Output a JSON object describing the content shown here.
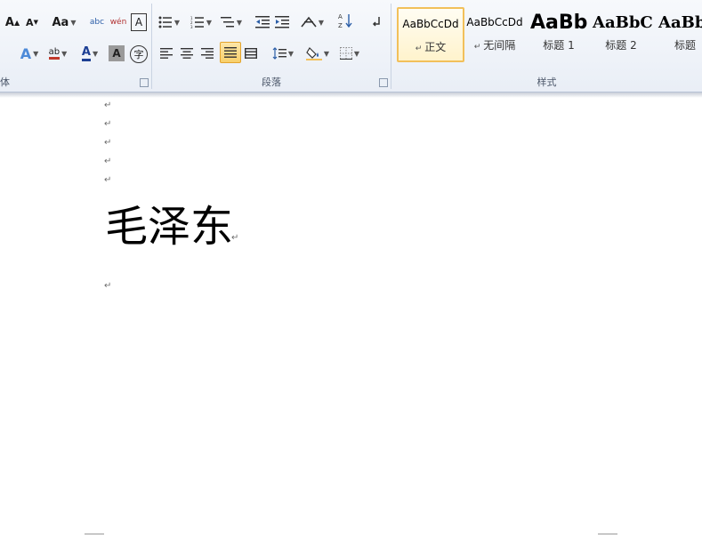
{
  "ribbon": {
    "font_group": {
      "label": "体",
      "grow_font": "A",
      "shrink_font": "A",
      "change_case": "Aa",
      "phonetic": "abc",
      "enclose": "wén",
      "border_char": "A",
      "text_effect": "A",
      "highlight": "ab",
      "font_color": "A",
      "char_shading": "A",
      "enclose_char": "字"
    },
    "paragraph_group": {
      "label": "段落"
    },
    "styles_group": {
      "label": "样式",
      "styles": [
        {
          "sample": "AaBbCcDd",
          "name": "正文"
        },
        {
          "sample": "AaBbCcDd",
          "name": "无间隔"
        },
        {
          "sample": "AaBb",
          "name": "标题 1"
        },
        {
          "sample": "AaBbC",
          "name": "标题 2"
        },
        {
          "sample": "AaBb",
          "name": "标题"
        }
      ]
    }
  },
  "document": {
    "paragraph_mark": "↵",
    "main_text": "毛泽东"
  }
}
